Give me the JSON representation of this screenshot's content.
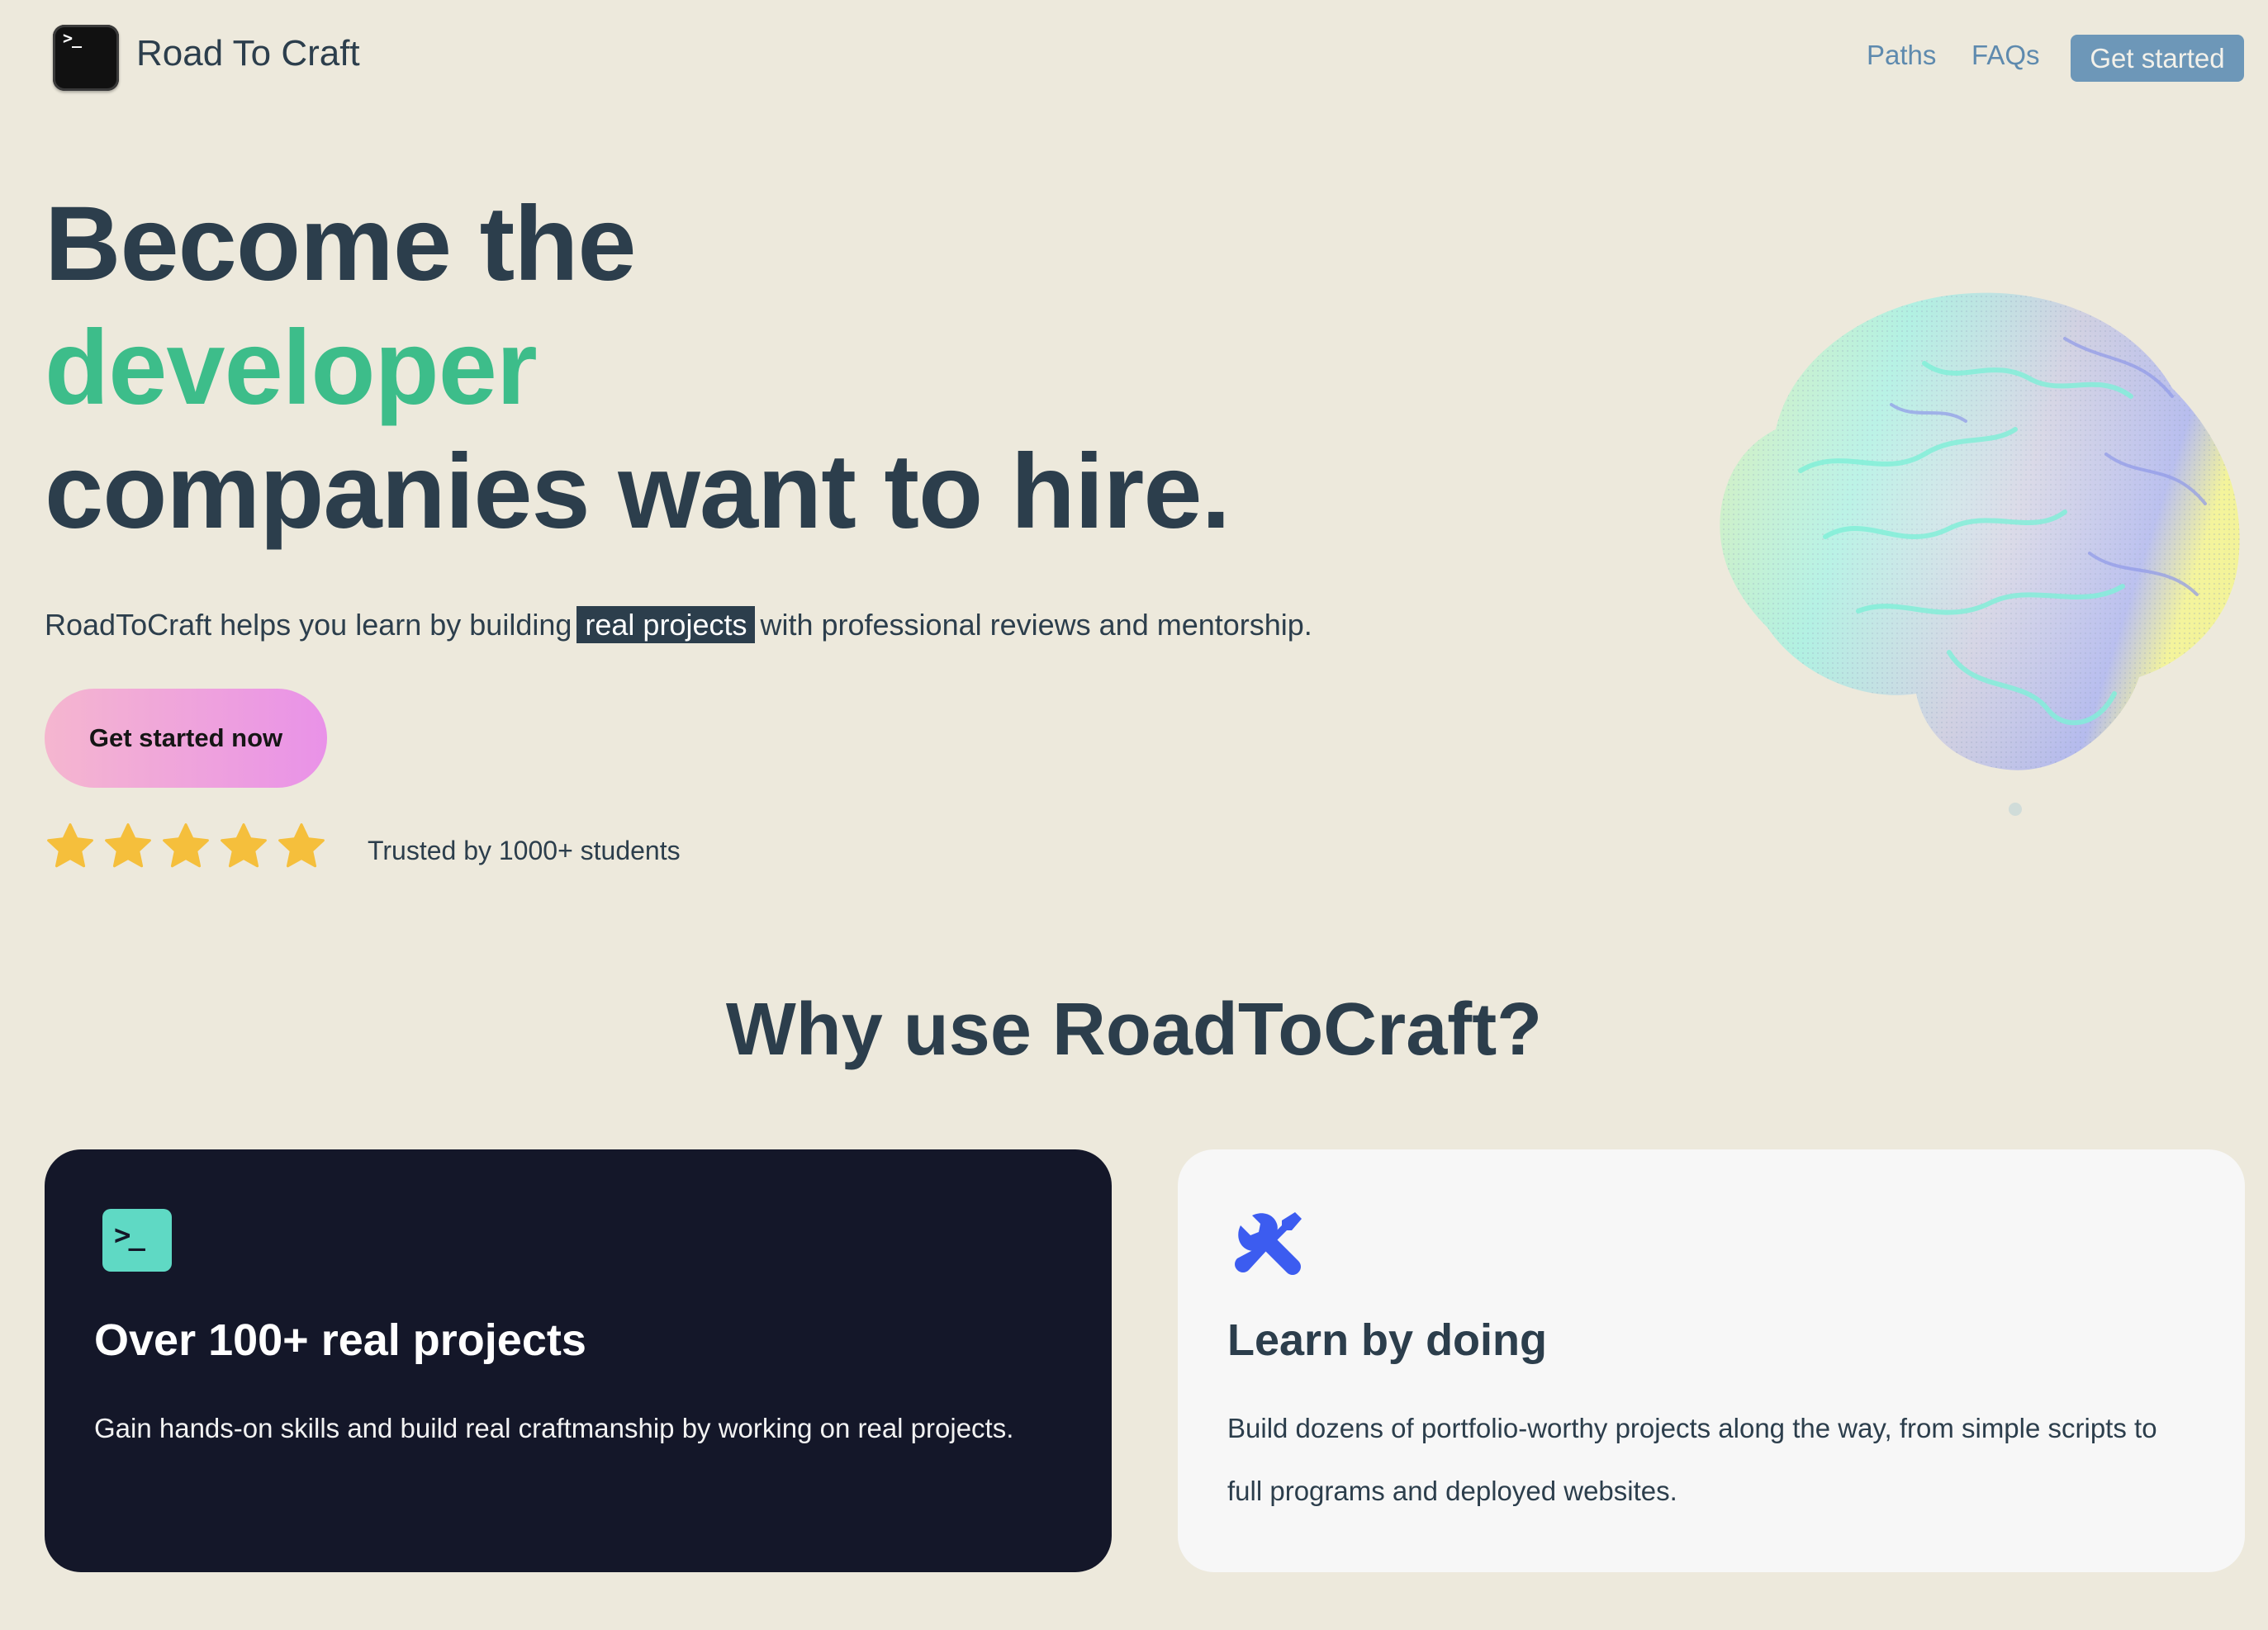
{
  "header": {
    "brand": "Road To Craft",
    "nav": {
      "paths": "Paths",
      "faqs": "FAQs",
      "cta": "Get started"
    }
  },
  "hero": {
    "line1": "Become the",
    "line2": "developer",
    "line3": "companies want to hire.",
    "subtitle_before": "RoadToCraft helps you learn by building",
    "subtitle_highlight": "real projects",
    "subtitle_after": "with professional reviews and mentorship.",
    "cta": "Get started now",
    "rating": 5,
    "trusted": "Trusted by 1000+ students"
  },
  "why": {
    "title": "Why use RoadToCraft?",
    "cards": [
      {
        "icon": "terminal-icon",
        "title": "Over 100+ real projects",
        "text": "Gain hands-on skills and build real craftmanship by working on real projects."
      },
      {
        "icon": "tools-icon",
        "title": "Learn by doing",
        "text": "Build dozens of portfolio-worthy projects along the way, from simple scripts to full programs and deployed websites."
      }
    ]
  },
  "colors": {
    "background": "#EDE9DC",
    "text": "#2C3E4C",
    "accent_green": "#3DBD8A",
    "nav_blue": "#5E8AAE",
    "star": "#F5BF3C",
    "dark_card": "#141729",
    "tool_icon": "#3C5CF0"
  }
}
